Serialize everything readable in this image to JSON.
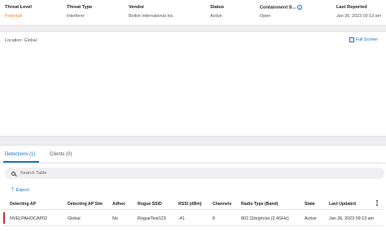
{
  "threat_table": {
    "headers": {
      "threat_level": "Threat Level",
      "threat_type": "Threat Type",
      "vendor": "Vendor",
      "status": "Status",
      "containment": "Containment S...",
      "last_reported": "Last Reported"
    },
    "row": {
      "threat_level": "Potential",
      "threat_type": "Interferer",
      "vendor": "Belkin International Inc.",
      "status": "Active",
      "containment": "Open",
      "last_reported": "Jan 26, 2023 09:13 am"
    },
    "threat_level_color": "#f0862a",
    "info_icon": "info-icon"
  },
  "map": {
    "location": "Location: Global",
    "full_screen": "Full Screen",
    "full_screen_icon": "expand-icon"
  },
  "tabs": [
    {
      "label": "Detections (1)",
      "active": true
    },
    {
      "label": "Clients (0)",
      "active": false
    }
  ],
  "search": {
    "placeholder": "Search Table",
    "value": ""
  },
  "export": {
    "label": "Export",
    "icon": "arrow-up-icon"
  },
  "detections": {
    "headers": [
      "Detecting AP",
      "Detecting AP Site",
      "Adhoc",
      "Rogue SSID",
      "RSSI (dBm)",
      "Channels",
      "Radio Type (Band)",
      "State",
      "Last Updated"
    ],
    "rows": [
      [
        "NVELPAHOCAP02",
        "Global",
        "No",
        "RogueTest123",
        "-41",
        "8",
        "802.11b/g/n/ax (2.4GHz)",
        "Active",
        "Jan 26, 2023 09:13 am"
      ]
    ],
    "row_status_color": "#d9262a"
  },
  "colors": {
    "accent": "#1a73c8",
    "panel_grey": "#eeeef0"
  }
}
